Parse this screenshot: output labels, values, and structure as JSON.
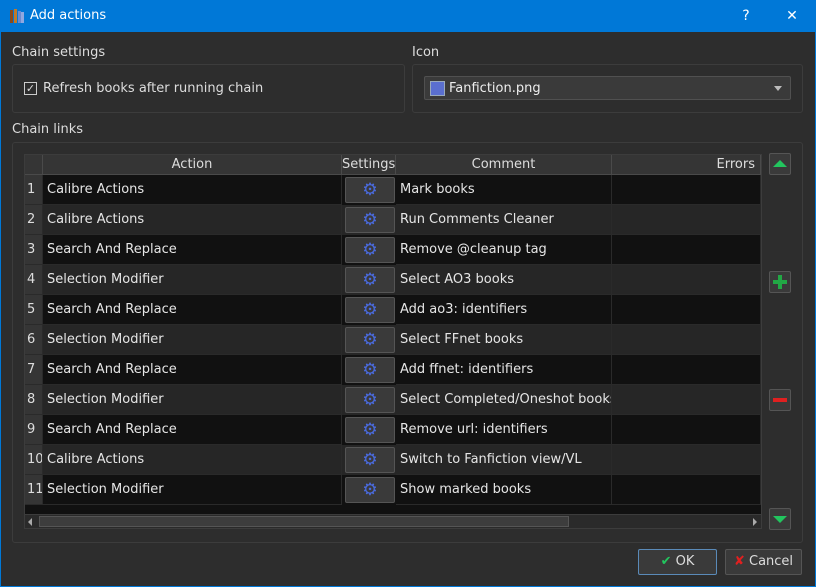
{
  "window": {
    "title": "Add actions",
    "help": "?",
    "close": "✕"
  },
  "chain_settings": {
    "label": "Chain settings",
    "refresh_checkbox": {
      "label": "Refresh books after running chain",
      "checked": true
    }
  },
  "icon": {
    "label": "Icon",
    "value": "Fanfiction.png"
  },
  "chain_links": {
    "label": "Chain links",
    "columns": [
      "Action",
      "Settings",
      "Comment",
      "Errors"
    ],
    "rows": [
      {
        "n": "1",
        "action": "Calibre Actions",
        "comment": "Mark books",
        "errors": ""
      },
      {
        "n": "2",
        "action": "Calibre Actions",
        "comment": "Run Comments Cleaner",
        "errors": ""
      },
      {
        "n": "3",
        "action": "Search And Replace",
        "comment": "Remove @cleanup tag",
        "errors": ""
      },
      {
        "n": "4",
        "action": "Selection Modifier",
        "comment": "Select AO3 books",
        "errors": ""
      },
      {
        "n": "5",
        "action": "Search And Replace",
        "comment": "Add ao3: identifiers",
        "errors": ""
      },
      {
        "n": "6",
        "action": "Selection Modifier",
        "comment": "Select FFnet books",
        "errors": ""
      },
      {
        "n": "7",
        "action": "Search And Replace",
        "comment": "Add ffnet: identifiers",
        "errors": ""
      },
      {
        "n": "8",
        "action": "Selection Modifier",
        "comment": "Select Completed/Oneshot books",
        "errors": ""
      },
      {
        "n": "9",
        "action": "Search And Replace",
        "comment": "Remove url: identifiers",
        "errors": ""
      },
      {
        "n": "10",
        "action": "Calibre Actions",
        "comment": "Switch to Fanfiction view/VL",
        "errors": ""
      },
      {
        "n": "11",
        "action": "Selection Modifier",
        "comment": "Show marked books",
        "errors": ""
      }
    ]
  },
  "buttons": {
    "ok": "OK",
    "cancel": "Cancel"
  },
  "colors": {
    "accent": "#0078d7",
    "green": "#22c55e",
    "red": "#e02020",
    "gear": "#4a6be0"
  }
}
